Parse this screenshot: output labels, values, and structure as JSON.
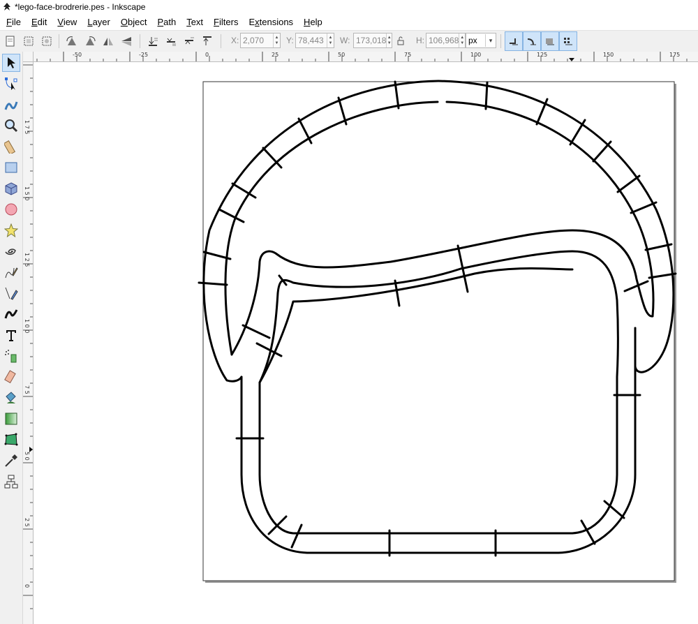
{
  "window": {
    "title": "*lego-face-brodrerie.pes - Inkscape"
  },
  "menu": {
    "items": [
      "File",
      "Edit",
      "View",
      "Layer",
      "Object",
      "Path",
      "Text",
      "Filters",
      "Extensions",
      "Help"
    ],
    "mnemonics": [
      "F",
      "E",
      "V",
      "L",
      "O",
      "P",
      "T",
      "F",
      "x",
      "H"
    ]
  },
  "toolbar": {
    "x_label": "X:",
    "x_value": "2,070",
    "y_label": "Y:",
    "y_value": "78,443",
    "w_label": "W:",
    "w_value": "173,018",
    "h_label": "H:",
    "h_value": "106,968",
    "unit": "px"
  },
  "rulers": {
    "horizontal": [
      "-50",
      "-25",
      "0",
      "25",
      "50",
      "75",
      "100",
      "125",
      "150",
      "175"
    ],
    "vertical": [
      "1\n7\n5",
      "1\n5\n0",
      "1\n2\n5",
      "1\n0\n0",
      "7\n5",
      "5\n0",
      "2\n5",
      "0"
    ]
  },
  "tools": [
    "selector-tool",
    "node-tool",
    "tweak-tool",
    "zoom-tool",
    "measure-tool",
    "rect-tool",
    "3dbox-tool",
    "ellipse-tool",
    "star-tool",
    "spiral-tool",
    "pencil-tool",
    "pen-tool",
    "calligraphy-tool",
    "text-tool",
    "spray-tool",
    "eraser-tool",
    "bucket-tool",
    "gradient-tool",
    "mesh-tool",
    "dropper-tool",
    "connector-tool"
  ],
  "colors": {
    "accent": "#cfe4f9",
    "accent_border": "#86b4e3",
    "stroke": "#000000"
  }
}
